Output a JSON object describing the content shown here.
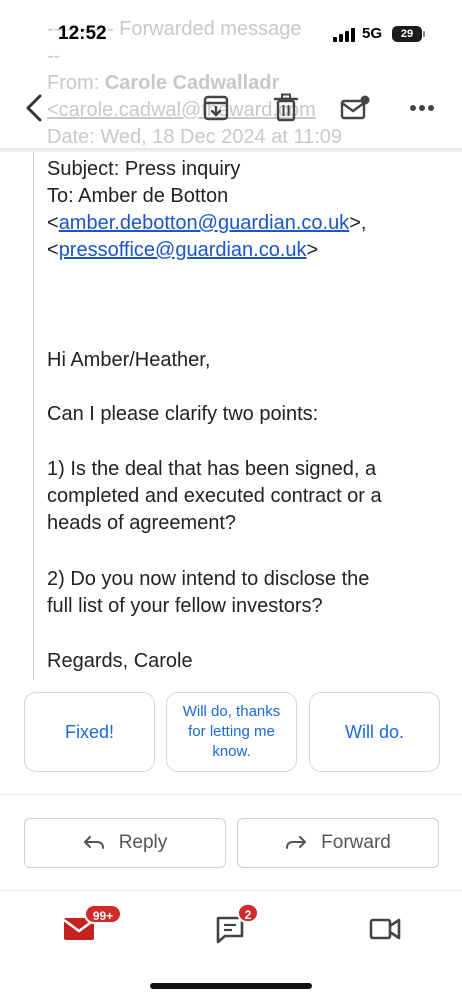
{
  "status_bar": {
    "time": "12:52",
    "network": "5G",
    "battery": "29"
  },
  "faded_header": {
    "forwarded_line": "---------- Forwarded message",
    "dashes": "--",
    "from_label": "From: ",
    "from_name": "Carole Cadwalladr",
    "from_email_start": "<carole.cadwal",
    "from_email_end": "@the",
    "from_email_tail": "ward",
    "from_email_suffix": ".com",
    "date_line": "Date: Wed, 18 Dec 2024 at 11:09"
  },
  "toolbar": {
    "back_icon": "back-arrow-icon",
    "archive_icon": "archive-icon",
    "delete_icon": "trash-icon",
    "mark_unread_icon": "mark-unread-icon",
    "more_icon": "more-horizontal-icon"
  },
  "email": {
    "subject_line": "Subject: Press inquiry",
    "to_line": "To: Amber de Botton",
    "to_email_1_open": "<",
    "to_email_1": "amber.debotton@guardian.co.uk",
    "to_email_1_close": ">,",
    "to_email_2_open": "<",
    "to_email_2": "pressoffice@guardian.co.uk",
    "to_email_2_close": ">",
    "greeting": "Hi Amber/Heather,",
    "intro": "Can I please clarify two points:",
    "point1_line1": "1) Is the deal that has been signed, a",
    "point1_line2": "completed and executed contract or a",
    "point1_line3": "heads of agreement?",
    "point2_line1": "2) Do you now intend to disclose the",
    "point2_line2": "full list of your fellow investors?",
    "signoff": "Regards, Carole"
  },
  "smart_replies": [
    {
      "label": "Fixed!"
    },
    {
      "line1": "Will do, thanks",
      "line2": "for letting me",
      "line3": "know."
    },
    {
      "label": "Will do."
    }
  ],
  "actions": {
    "reply": "Reply",
    "forward": "Forward"
  },
  "bottom_nav": {
    "mail_badge": "99+",
    "chat_badge": "2",
    "mail_icon": "mail-icon",
    "chat_icon": "chat-icon",
    "meet_icon": "video-camera-icon"
  },
  "colors": {
    "accent": "#1a6ad8",
    "link": "#1a55c9",
    "badge": "#d02b2b",
    "mail_red": "#c5221f"
  }
}
